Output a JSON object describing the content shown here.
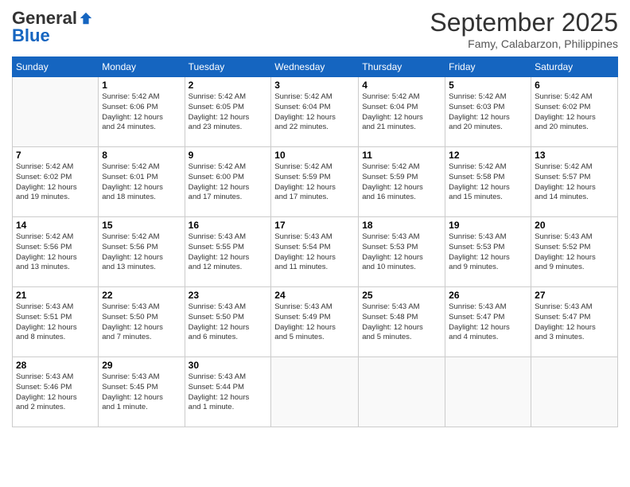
{
  "header": {
    "logo_general": "General",
    "logo_blue": "Blue",
    "month": "September 2025",
    "location": "Famy, Calabarzon, Philippines"
  },
  "days_of_week": [
    "Sunday",
    "Monday",
    "Tuesday",
    "Wednesday",
    "Thursday",
    "Friday",
    "Saturday"
  ],
  "weeks": [
    [
      {
        "day": "",
        "info": ""
      },
      {
        "day": "1",
        "info": "Sunrise: 5:42 AM\nSunset: 6:06 PM\nDaylight: 12 hours\nand 24 minutes."
      },
      {
        "day": "2",
        "info": "Sunrise: 5:42 AM\nSunset: 6:05 PM\nDaylight: 12 hours\nand 23 minutes."
      },
      {
        "day": "3",
        "info": "Sunrise: 5:42 AM\nSunset: 6:04 PM\nDaylight: 12 hours\nand 22 minutes."
      },
      {
        "day": "4",
        "info": "Sunrise: 5:42 AM\nSunset: 6:04 PM\nDaylight: 12 hours\nand 21 minutes."
      },
      {
        "day": "5",
        "info": "Sunrise: 5:42 AM\nSunset: 6:03 PM\nDaylight: 12 hours\nand 20 minutes."
      },
      {
        "day": "6",
        "info": "Sunrise: 5:42 AM\nSunset: 6:02 PM\nDaylight: 12 hours\nand 20 minutes."
      }
    ],
    [
      {
        "day": "7",
        "info": "Sunrise: 5:42 AM\nSunset: 6:02 PM\nDaylight: 12 hours\nand 19 minutes."
      },
      {
        "day": "8",
        "info": "Sunrise: 5:42 AM\nSunset: 6:01 PM\nDaylight: 12 hours\nand 18 minutes."
      },
      {
        "day": "9",
        "info": "Sunrise: 5:42 AM\nSunset: 6:00 PM\nDaylight: 12 hours\nand 17 minutes."
      },
      {
        "day": "10",
        "info": "Sunrise: 5:42 AM\nSunset: 5:59 PM\nDaylight: 12 hours\nand 17 minutes."
      },
      {
        "day": "11",
        "info": "Sunrise: 5:42 AM\nSunset: 5:59 PM\nDaylight: 12 hours\nand 16 minutes."
      },
      {
        "day": "12",
        "info": "Sunrise: 5:42 AM\nSunset: 5:58 PM\nDaylight: 12 hours\nand 15 minutes."
      },
      {
        "day": "13",
        "info": "Sunrise: 5:42 AM\nSunset: 5:57 PM\nDaylight: 12 hours\nand 14 minutes."
      }
    ],
    [
      {
        "day": "14",
        "info": "Sunrise: 5:42 AM\nSunset: 5:56 PM\nDaylight: 12 hours\nand 13 minutes."
      },
      {
        "day": "15",
        "info": "Sunrise: 5:42 AM\nSunset: 5:56 PM\nDaylight: 12 hours\nand 13 minutes."
      },
      {
        "day": "16",
        "info": "Sunrise: 5:43 AM\nSunset: 5:55 PM\nDaylight: 12 hours\nand 12 minutes."
      },
      {
        "day": "17",
        "info": "Sunrise: 5:43 AM\nSunset: 5:54 PM\nDaylight: 12 hours\nand 11 minutes."
      },
      {
        "day": "18",
        "info": "Sunrise: 5:43 AM\nSunset: 5:53 PM\nDaylight: 12 hours\nand 10 minutes."
      },
      {
        "day": "19",
        "info": "Sunrise: 5:43 AM\nSunset: 5:53 PM\nDaylight: 12 hours\nand 9 minutes."
      },
      {
        "day": "20",
        "info": "Sunrise: 5:43 AM\nSunset: 5:52 PM\nDaylight: 12 hours\nand 9 minutes."
      }
    ],
    [
      {
        "day": "21",
        "info": "Sunrise: 5:43 AM\nSunset: 5:51 PM\nDaylight: 12 hours\nand 8 minutes."
      },
      {
        "day": "22",
        "info": "Sunrise: 5:43 AM\nSunset: 5:50 PM\nDaylight: 12 hours\nand 7 minutes."
      },
      {
        "day": "23",
        "info": "Sunrise: 5:43 AM\nSunset: 5:50 PM\nDaylight: 12 hours\nand 6 minutes."
      },
      {
        "day": "24",
        "info": "Sunrise: 5:43 AM\nSunset: 5:49 PM\nDaylight: 12 hours\nand 5 minutes."
      },
      {
        "day": "25",
        "info": "Sunrise: 5:43 AM\nSunset: 5:48 PM\nDaylight: 12 hours\nand 5 minutes."
      },
      {
        "day": "26",
        "info": "Sunrise: 5:43 AM\nSunset: 5:47 PM\nDaylight: 12 hours\nand 4 minutes."
      },
      {
        "day": "27",
        "info": "Sunrise: 5:43 AM\nSunset: 5:47 PM\nDaylight: 12 hours\nand 3 minutes."
      }
    ],
    [
      {
        "day": "28",
        "info": "Sunrise: 5:43 AM\nSunset: 5:46 PM\nDaylight: 12 hours\nand 2 minutes."
      },
      {
        "day": "29",
        "info": "Sunrise: 5:43 AM\nSunset: 5:45 PM\nDaylight: 12 hours\nand 1 minute."
      },
      {
        "day": "30",
        "info": "Sunrise: 5:43 AM\nSunset: 5:44 PM\nDaylight: 12 hours\nand 1 minute."
      },
      {
        "day": "",
        "info": ""
      },
      {
        "day": "",
        "info": ""
      },
      {
        "day": "",
        "info": ""
      },
      {
        "day": "",
        "info": ""
      }
    ]
  ]
}
